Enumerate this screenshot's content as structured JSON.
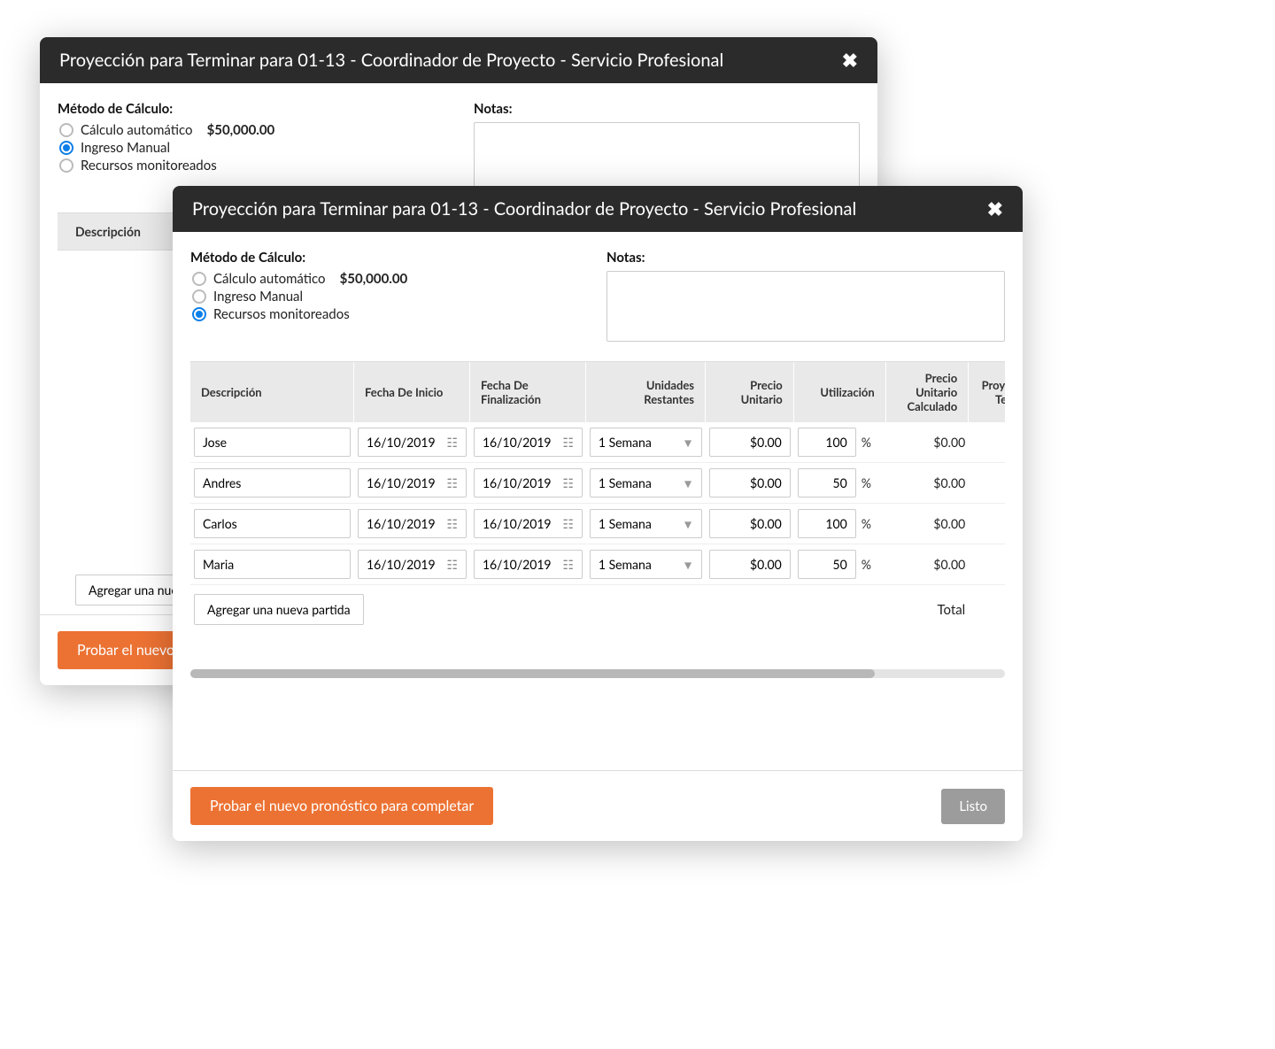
{
  "modalBack": {
    "title": "Proyección para Terminar para 01-13 - Coordinador de Proyecto - Servicio Profesional",
    "calcMethodLabel": "Método de Cálculo:",
    "notesLabel": "Notas:",
    "radios": {
      "auto": "Cálculo automático",
      "autoValue": "$50,000.00",
      "manual": "Ingreso Manual",
      "monitored": "Recursos monitoreados"
    },
    "tableHeader": "Descripción",
    "addButton": "Agregar una nueva partida",
    "primaryButtonPartial": "Probar el nuevo"
  },
  "modalFront": {
    "title": "Proyección para Terminar para 01-13 - Coordinador de Proyecto - Servicio Profesional",
    "calcMethodLabel": "Método de Cálculo:",
    "notesLabel": "Notas:",
    "radios": {
      "auto": "Cálculo automático",
      "autoValue": "$50,000.00",
      "manual": "Ingreso Manual",
      "monitored": "Recursos monitoreados"
    },
    "columns": {
      "description": "Descripción",
      "startDate": "Fecha De Inicio",
      "endDate": "Fecha De Finalización",
      "remainingUnits": "Unidades Restantes",
      "unitPrice": "Precio Unitario",
      "utilization": "Utilización",
      "calcUnitPrice": "Precio Unitario Calculado",
      "projPartial": "Proye",
      "projPartial2": "Ter"
    },
    "rows": [
      {
        "description": "Jose",
        "startDate": "16/10/2019",
        "endDate": "16/10/2019",
        "remainingUnits": "1 Semana",
        "unitPrice": "$0.00",
        "utilization": "100",
        "calcUnitPrice": "$0.00"
      },
      {
        "description": "Andres",
        "startDate": "16/10/2019",
        "endDate": "16/10/2019",
        "remainingUnits": "1 Semana",
        "unitPrice": "$0.00",
        "utilization": "50",
        "calcUnitPrice": "$0.00"
      },
      {
        "description": "Carlos",
        "startDate": "16/10/2019",
        "endDate": "16/10/2019",
        "remainingUnits": "1 Semana",
        "unitPrice": "$0.00",
        "utilization": "100",
        "calcUnitPrice": "$0.00"
      },
      {
        "description": "Maria",
        "startDate": "16/10/2019",
        "endDate": "16/10/2019",
        "remainingUnits": "1 Semana",
        "unitPrice": "$0.00",
        "utilization": "50",
        "calcUnitPrice": "$0.00"
      }
    ],
    "addButton": "Agregar una nueva partida",
    "totalLabel": "Total",
    "pctSign": "%",
    "primaryButton": "Probar el nuevo pronóstico para completar",
    "secondaryButton": "Listo"
  }
}
